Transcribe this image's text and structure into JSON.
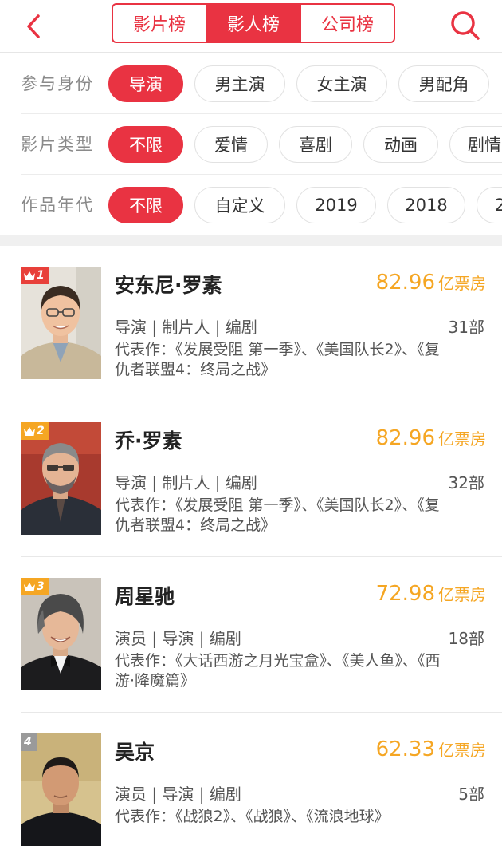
{
  "header": {
    "tabs": [
      "影片榜",
      "影人榜",
      "公司榜"
    ],
    "active_tab": 1
  },
  "filters": [
    {
      "label": "参与身份",
      "options": [
        "导演",
        "男主演",
        "女主演",
        "男配角"
      ],
      "selected": 0
    },
    {
      "label": "影片类型",
      "options": [
        "不限",
        "爱情",
        "喜剧",
        "动画",
        "剧情"
      ],
      "selected": 0
    },
    {
      "label": "作品年代",
      "options": [
        "不限",
        "自定义",
        "2019",
        "2018",
        "2"
      ],
      "selected": 0
    }
  ],
  "list": [
    {
      "rank": "1",
      "name": "安东尼·罗素",
      "box_office": "82.96",
      "box_unit": "亿票房",
      "roles": "导演 | 制片人 | 编剧",
      "count": "31部",
      "works": "代表作：《发展受阻 第一季》、《美国队长2》、《复仇者联盟4：终局之战》"
    },
    {
      "rank": "2",
      "name": "乔·罗素",
      "box_office": "82.96",
      "box_unit": "亿票房",
      "roles": "导演 | 制片人 | 编剧",
      "count": "32部",
      "works": "代表作：《发展受阻 第一季》、《美国队长2》、《复仇者联盟4：终局之战》"
    },
    {
      "rank": "3",
      "name": "周星驰",
      "box_office": "72.98",
      "box_unit": "亿票房",
      "roles": "演员 | 导演 | 编剧",
      "count": "18部",
      "works": "代表作：《大话西游之月光宝盒》、《美人鱼》、《西游·降魔篇》"
    },
    {
      "rank": "4",
      "name": "吴京",
      "box_office": "62.33",
      "box_unit": "亿票房",
      "roles": "演员 | 导演 | 编剧",
      "count": "5部",
      "works": "代表作：《战狼2》、《战狼》、《流浪地球》"
    }
  ],
  "icons": {
    "back": "chevron-left-icon",
    "search": "search-icon",
    "rank_top": "crown-icon"
  },
  "colors": {
    "accent": "#e93342",
    "box_office": "#f5a623",
    "rank_1": "#e8403a",
    "rank_top3": "#f5a623",
    "rank_other": "#9a9a9a"
  }
}
